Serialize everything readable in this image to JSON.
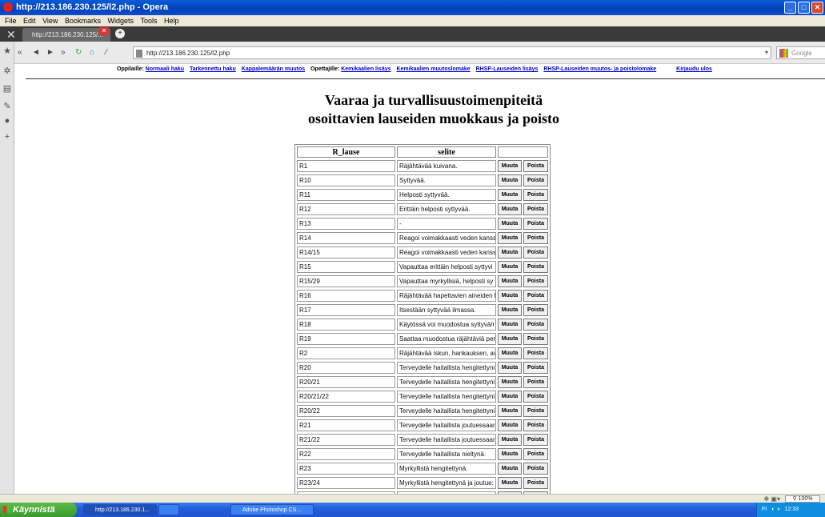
{
  "window": {
    "title": "http://213.186.230.125/l2.php - Opera"
  },
  "menu": [
    "File",
    "Edit",
    "View",
    "Bookmarks",
    "Widgets",
    "Tools",
    "Help"
  ],
  "tab": {
    "label": "http://213.186.230.125/..."
  },
  "address": {
    "url": "http://213.186.230.125/l2.php"
  },
  "search": {
    "placeholder": "Google"
  },
  "links": {
    "students_label": "Oppilaille:",
    "students": [
      "Normaali haku",
      "Tarkennettu haku",
      "Kappalemäärän muutos"
    ],
    "teachers_label": "Opettajille:",
    "teachers": [
      "Kemikaalien lisäys",
      "Kemikaalien muutoslomake",
      "RHSP-Lauseiden lisäys",
      "RHSP-Lauseiden muutos- ja poistolomake"
    ],
    "logout": "Kirjaudu ulos"
  },
  "heading": {
    "line1": "Vaaraa ja turvallisuustoimenpiteitä",
    "line2": "osoittavien lauseiden muokkaus ja poisto"
  },
  "table": {
    "headers": [
      "R_lause",
      "selite"
    ],
    "edit_label": "Muuta",
    "delete_label": "Poista",
    "rows": [
      {
        "code": "R1",
        "desc": "Räjähtävää kuivana."
      },
      {
        "code": "R10",
        "desc": "Syttyvää."
      },
      {
        "code": "R11",
        "desc": "Helposti syttyvää."
      },
      {
        "code": "R12",
        "desc": "Erittäin helposti syttyvää."
      },
      {
        "code": "R13",
        "desc": "-"
      },
      {
        "code": "R14",
        "desc": "Reagoi voimakkaasti veden kanss"
      },
      {
        "code": "R14/15",
        "desc": "Reagoi voimakkaasti veden kanss"
      },
      {
        "code": "R15",
        "desc": "Vapauttaa erittäin helposti syttyvi"
      },
      {
        "code": "R15/29",
        "desc": "Vapauttaa myrkyllisiä, helposti sy"
      },
      {
        "code": "R16",
        "desc": "Räjähtävää hapettavien aineiden k"
      },
      {
        "code": "R17",
        "desc": "Itsestään syttyvää ilmassa."
      },
      {
        "code": "R18",
        "desc": "Käytössä voi muodostua syttyvä/r"
      },
      {
        "code": "R19",
        "desc": "Saattaa muodostua räjähtäviä per"
      },
      {
        "code": "R2",
        "desc": "Räjähtävää iskun, hankauksen, av"
      },
      {
        "code": "R20",
        "desc": "Terveydelle haitallista hengitettyni"
      },
      {
        "code": "R20/21",
        "desc": "Terveydelle haitallista hengitettyni"
      },
      {
        "code": "R20/21/22",
        "desc": "Terveydelle haitallista hengitettyni"
      },
      {
        "code": "R20/22",
        "desc": "Terveydelle haitallista hengitettyni"
      },
      {
        "code": "R21",
        "desc": "Terveydelle haitallista joutuessaar"
      },
      {
        "code": "R21/22",
        "desc": "Terveydelle haitallista joutuessaar"
      },
      {
        "code": "R22",
        "desc": "Terveydelle haitallista nieltynä."
      },
      {
        "code": "R23",
        "desc": "Myrkyllistä hengitettynä."
      },
      {
        "code": "R23/24",
        "desc": "Myrkyllistä hengitettynä ja joutue:"
      },
      {
        "code": "R23/24/25",
        "desc": "Myrkyllistä hengitettynä, joutuess"
      },
      {
        "code": "R23/25",
        "desc": "Myrkyllistä hengitettynä ja nieltyn"
      }
    ]
  },
  "status": {
    "zoom": "100%"
  },
  "taskbar": {
    "start": "Käynnistä",
    "tasks": [
      "http://213.186.230.1...",
      "Adobe Photoshop CS..."
    ],
    "tray_lang": "FI",
    "clock": "12:33"
  }
}
